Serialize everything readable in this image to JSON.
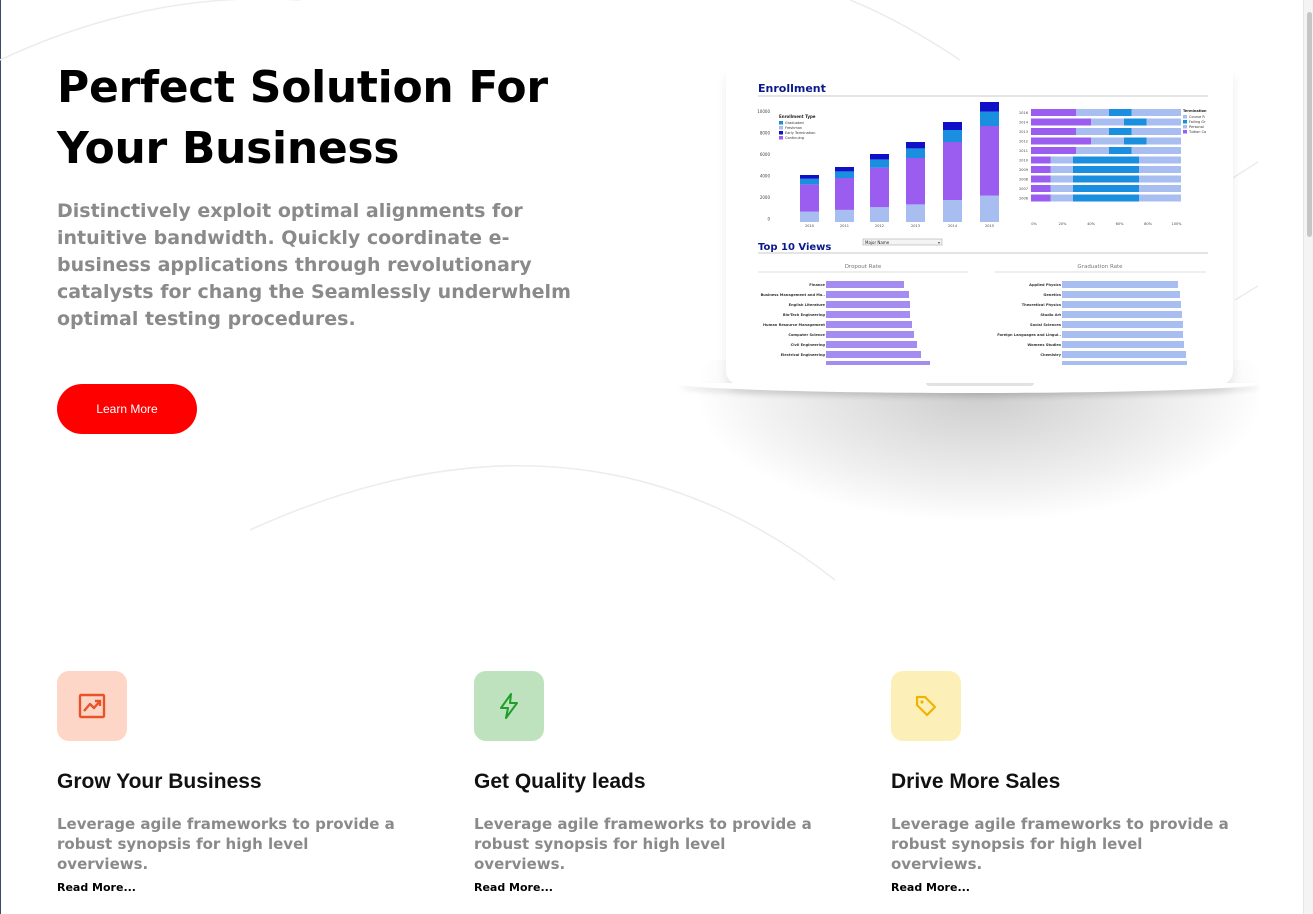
{
  "hero": {
    "title_line1": "Perfect Solution For",
    "title_line2": "Your Business",
    "description": "Distinctively exploit optimal alignments for intuitive bandwidth. Quickly coordinate e-business applications through revolutionary catalysts for chang the Seamlessly underwhelm optimal testing procedures.",
    "cta_label": "Learn More",
    "cta_color": "#ff0000"
  },
  "dashboard": {
    "enrollment_title": "Enrollment",
    "legend_title": "Enrollment Type",
    "legend": [
      "Graduated",
      "Freshman",
      "Early Termination",
      "Continuing"
    ],
    "y_ticks": [
      "10000",
      "8000",
      "6000",
      "4000",
      "2000",
      "0"
    ],
    "years": [
      "2010",
      "2011",
      "2012",
      "2013",
      "2014",
      "2015"
    ],
    "termination_label": "Termination",
    "termination_legend": [
      "Course R",
      "Failing Gr",
      "Personal",
      "Tuition Co"
    ],
    "hbar_years": [
      "2016",
      "2014",
      "2013",
      "2012",
      "2011",
      "2010",
      "2009",
      "2008",
      "2007",
      "2006"
    ],
    "pct_ticks": [
      "0%",
      "20%",
      "40%",
      "60%",
      "80%",
      "100%"
    ],
    "top_views_title": "Top 10 Views",
    "dropdown_value": "Major Name",
    "dropout_title": "Dropout Rate",
    "graduation_title": "Graduation Rate",
    "dropout_majors": [
      "Finance",
      "Business Management and Ma..",
      "English Literature",
      "Bio-Tech Engineering",
      "Human Resource Management",
      "Computer Science",
      "Civil Engineering",
      "Electrical Engineering"
    ],
    "graduation_majors": [
      "Applied Physics",
      "Genetics",
      "Theoretical Physics",
      "Studio Art",
      "Social Sciences",
      "Foreign Languages and Lingui..",
      "Womens Studies",
      "Chemistry"
    ],
    "colors": {
      "purple": "#9b5cf0",
      "light_blue": "#a8bdf0",
      "blue": "#1a8fe0",
      "navy": "#1010c8",
      "title": "#0a1a8a"
    }
  },
  "features": [
    {
      "title": "Grow Your Business",
      "description": "Leverage agile frameworks to provide a robust synopsis for high level overviews.",
      "link": "Read More...",
      "icon": "trending-up-icon",
      "bg": "#fdd6c8",
      "fg": "#e8542a"
    },
    {
      "title": "Get Quality leads",
      "description": "Leverage agile frameworks to provide a robust synopsis for high level overviews.",
      "link": "Read More...",
      "icon": "lightning-icon",
      "bg": "#bde2bd",
      "fg": "#1e9e2a"
    },
    {
      "title": "Drive More Sales",
      "description": "Leverage agile frameworks to provide a robust synopsis for high level overviews.",
      "link": "Read More...",
      "icon": "tag-icon",
      "bg": "#fdefb8",
      "fg": "#f0b400"
    }
  ]
}
